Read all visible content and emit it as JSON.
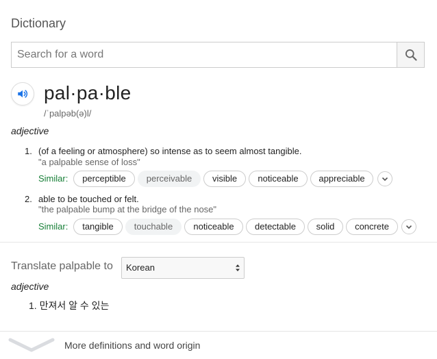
{
  "card": {
    "title": "Dictionary"
  },
  "search": {
    "placeholder": "Search for a word",
    "value": ""
  },
  "entry": {
    "headword": "pal·pa·ble",
    "phonetic": "/ˈpalpəb(ə)l/",
    "part_of_speech": "adjective",
    "definitions": [
      {
        "number": "1.",
        "text": "(of a feeling or atmosphere) so intense as to seem almost tangible.",
        "example": "\"a palpable sense of loss\"",
        "similar_label": "Similar:",
        "similar": [
          "perceptible",
          "perceivable",
          "visible",
          "noticeable",
          "appreciable"
        ]
      },
      {
        "number": "2.",
        "text": "able to be touched or felt.",
        "example": "\"the palpable bump at the bridge of the nose\"",
        "similar_label": "Similar:",
        "similar": [
          "tangible",
          "touchable",
          "noticeable",
          "detectable",
          "solid",
          "concrete"
        ]
      }
    ]
  },
  "translate": {
    "label": "Translate palpable to",
    "selected_language": "Korean",
    "part_of_speech": "adjective",
    "results": [
      {
        "number": "1.",
        "text": "만져서 알 수 있는"
      }
    ]
  },
  "footer": {
    "more_label": "More definitions and word origin"
  },
  "colors": {
    "similar_label": "#188038",
    "speaker_icon": "#1a73e8",
    "muted_chip_bg": "#f1f3f4"
  },
  "icons": {
    "search": "search-icon",
    "speaker": "speaker-icon",
    "expand": "chevron-down-icon",
    "select_arrows": "sort-arrows-icon",
    "more": "chevron-down-icon"
  }
}
